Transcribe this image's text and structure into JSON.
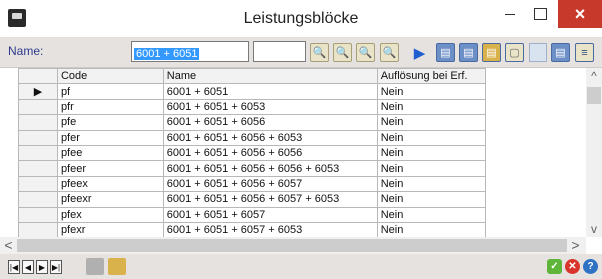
{
  "window": {
    "title": "Leistungsblöcke",
    "minimize": "",
    "maximize": "",
    "close": "×"
  },
  "filter": {
    "name_label": "Name:",
    "name_value": "6001 + 6051",
    "extra_value": ""
  },
  "table": {
    "columns": [
      "Code",
      "Name",
      "Auflösung bei Erf."
    ],
    "rows": [
      {
        "marker": "▶",
        "code": "pf",
        "name": "6001 + 6051",
        "aufloesung": "Nein"
      },
      {
        "marker": "",
        "code": "pfr",
        "name": "6001 + 6051 + 6053",
        "aufloesung": "Nein"
      },
      {
        "marker": "",
        "code": "pfe",
        "name": "6001 + 6051 + 6056",
        "aufloesung": "Nein"
      },
      {
        "marker": "",
        "code": "pfer",
        "name": "6001 + 6051 + 6056 + 6053",
        "aufloesung": "Nein"
      },
      {
        "marker": "",
        "code": "pfee",
        "name": "6001 + 6051 + 6056 + 6056",
        "aufloesung": "Nein"
      },
      {
        "marker": "",
        "code": "pfeer",
        "name": "6001 + 6051 + 6056 + 6056 + 6053",
        "aufloesung": "Nein"
      },
      {
        "marker": "",
        "code": "pfeex",
        "name": "6001 + 6051 + 6056 + 6057",
        "aufloesung": "Nein"
      },
      {
        "marker": "",
        "code": "pfeexr",
        "name": "6001 + 6051 + 6056 + 6057 + 6053",
        "aufloesung": "Nein"
      },
      {
        "marker": "",
        "code": "pfex",
        "name": "6001 + 6051 + 6057",
        "aufloesung": "Nein"
      },
      {
        "marker": "",
        "code": "pfexr",
        "name": "6001 + 6051 + 6057 + 6053",
        "aufloesung": "Nein"
      }
    ]
  },
  "scroll": {
    "up": "^",
    "down": "v",
    "left": "<",
    "right": ">"
  },
  "navigation": {
    "first": "|◀",
    "prev": "◀",
    "next": "▶",
    "last": "▶|"
  },
  "colors": {
    "accent": "#3399ff",
    "close": "#c7392b",
    "ok": "#5fb43a",
    "cancel": "#d9342b",
    "help": "#2f72c4"
  }
}
